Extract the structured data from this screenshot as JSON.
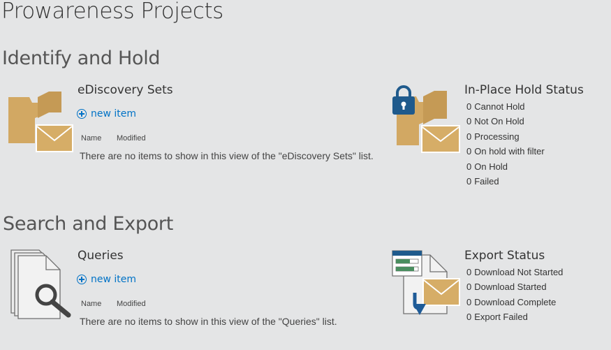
{
  "page": {
    "title": "Prowareness Projects"
  },
  "identify_hold": {
    "section_title": "Identify and Hold",
    "ediscovery": {
      "title": "eDiscovery Sets",
      "new_item_label": "new item",
      "columns": [
        "Name",
        "Modified"
      ],
      "empty_message": "There are no items to show in this view of the \"eDiscovery Sets\" list."
    },
    "hold_status": {
      "title": "In-Place Hold Status",
      "items": [
        {
          "count": "0",
          "label": "Cannot Hold"
        },
        {
          "count": "0",
          "label": "Not On Hold"
        },
        {
          "count": "0",
          "label": "Processing"
        },
        {
          "count": "0",
          "label": "On hold with filter"
        },
        {
          "count": "0",
          "label": "On Hold"
        },
        {
          "count": "0",
          "label": "Failed"
        }
      ]
    }
  },
  "search_export": {
    "section_title": "Search and Export",
    "queries": {
      "title": "Queries",
      "new_item_label": "new item",
      "columns": [
        "Name",
        "Modified"
      ],
      "empty_message": "There are no items to show in this view of the \"Queries\" list."
    },
    "export_status": {
      "title": "Export Status",
      "items": [
        {
          "count": "0",
          "label": "Download Not Started"
        },
        {
          "count": "0",
          "label": "Download Started"
        },
        {
          "count": "0",
          "label": "Download Complete"
        },
        {
          "count": "0",
          "label": "Export Failed"
        }
      ]
    }
  },
  "colors": {
    "folder": "#d2a863",
    "folder_dark": "#c59a55",
    "lock": "#1f5a8c",
    "link": "#0072c6",
    "arrow": "#1e5b97",
    "doc_stroke": "#6f6f6f",
    "background": "#e4e5e6"
  },
  "icons": {
    "ediscovery": "folder-envelope-icon",
    "hold": "lock-folder-envelope-icon",
    "queries": "documents-magnifier-icon",
    "export": "export-window-envelope-icon"
  }
}
